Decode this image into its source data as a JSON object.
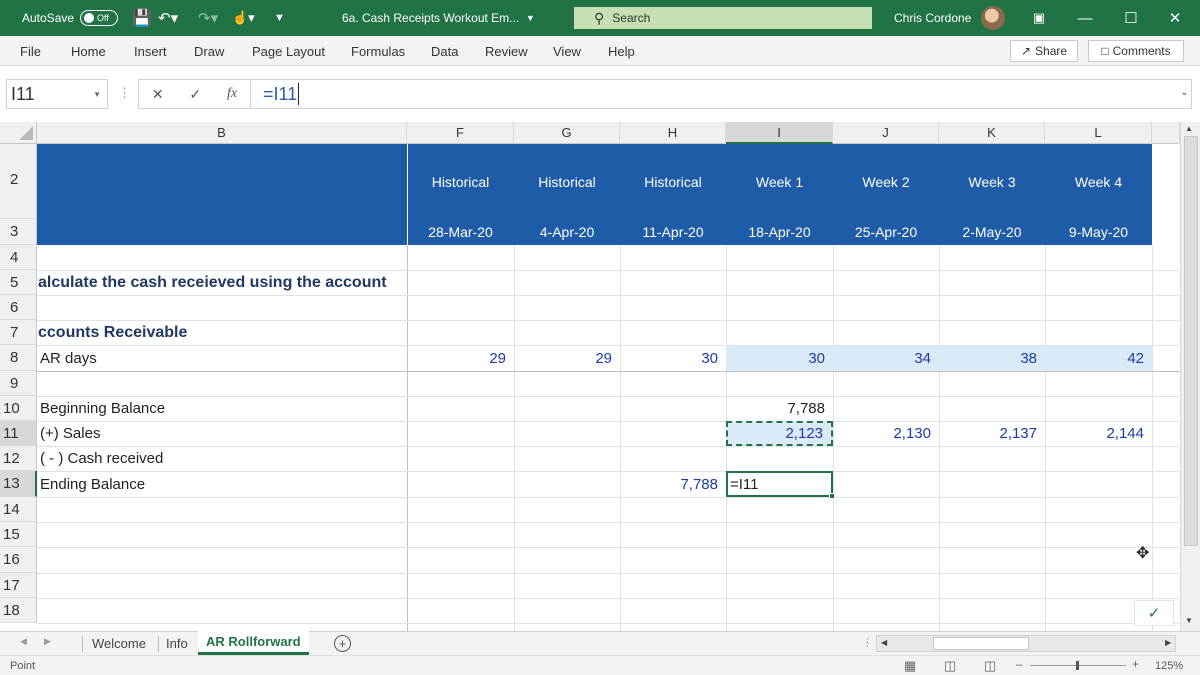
{
  "titlebar": {
    "autosave_label": "AutoSave",
    "autosave_state": "Off",
    "doc_title": "6a. Cash Receipts Workout Em...",
    "search_label": "Search",
    "user_name": "Chris Cordone"
  },
  "menu": {
    "items": [
      "File",
      "Home",
      "Insert",
      "Draw",
      "Page Layout",
      "Formulas",
      "Data",
      "Review",
      "View",
      "Help"
    ],
    "share_label": "Share",
    "comments_label": "Comments"
  },
  "formula_bar": {
    "name_box": "I11",
    "fx": "fx",
    "formula": "=I11"
  },
  "columns": [
    "B",
    "F",
    "G",
    "H",
    "I",
    "J",
    "K",
    "L"
  ],
  "rows": [
    "2",
    "3",
    "4",
    "5",
    "6",
    "7",
    "8",
    "9",
    "10",
    "11",
    "12",
    "13",
    "14",
    "15",
    "16",
    "17",
    "18"
  ],
  "header_band": {
    "row2": [
      "Historical",
      "Historical",
      "Historical",
      "Week 1",
      "Week 2",
      "Week 3",
      "Week 4"
    ],
    "row3": [
      "28-Mar-20",
      "4-Apr-20",
      "11-Apr-20",
      "18-Apr-20",
      "25-Apr-20",
      "2-May-20",
      "9-May-20"
    ]
  },
  "labels": {
    "r5": "alculate the cash receieved using the account",
    "r7": "ccounts Receivable",
    "r8": "AR days",
    "r10": "Beginning Balance",
    "r11": "(+) Sales",
    "r12": "( - ) Cash received",
    "r13": "Ending Balance"
  },
  "values": {
    "ar_days": [
      "29",
      "29",
      "30",
      "30",
      "34",
      "38",
      "42"
    ],
    "beginning_I": "7,788",
    "sales": [
      "2,123",
      "2,130",
      "2,137",
      "2,144"
    ],
    "ending_H": "7,788",
    "editing_I13": "=I11"
  },
  "sheets": {
    "tabs": [
      "Welcome",
      "Info",
      "AR Rollforward"
    ],
    "active": "AR Rollforward"
  },
  "status": {
    "mode": "Point",
    "zoom": "125%"
  },
  "colors": {
    "excel_green": "#217346",
    "band_blue": "#1f5ca8",
    "number_blue": "#1a3aa8",
    "label_navy": "#1f3864",
    "ar_highlight": "#dbeaf7"
  }
}
